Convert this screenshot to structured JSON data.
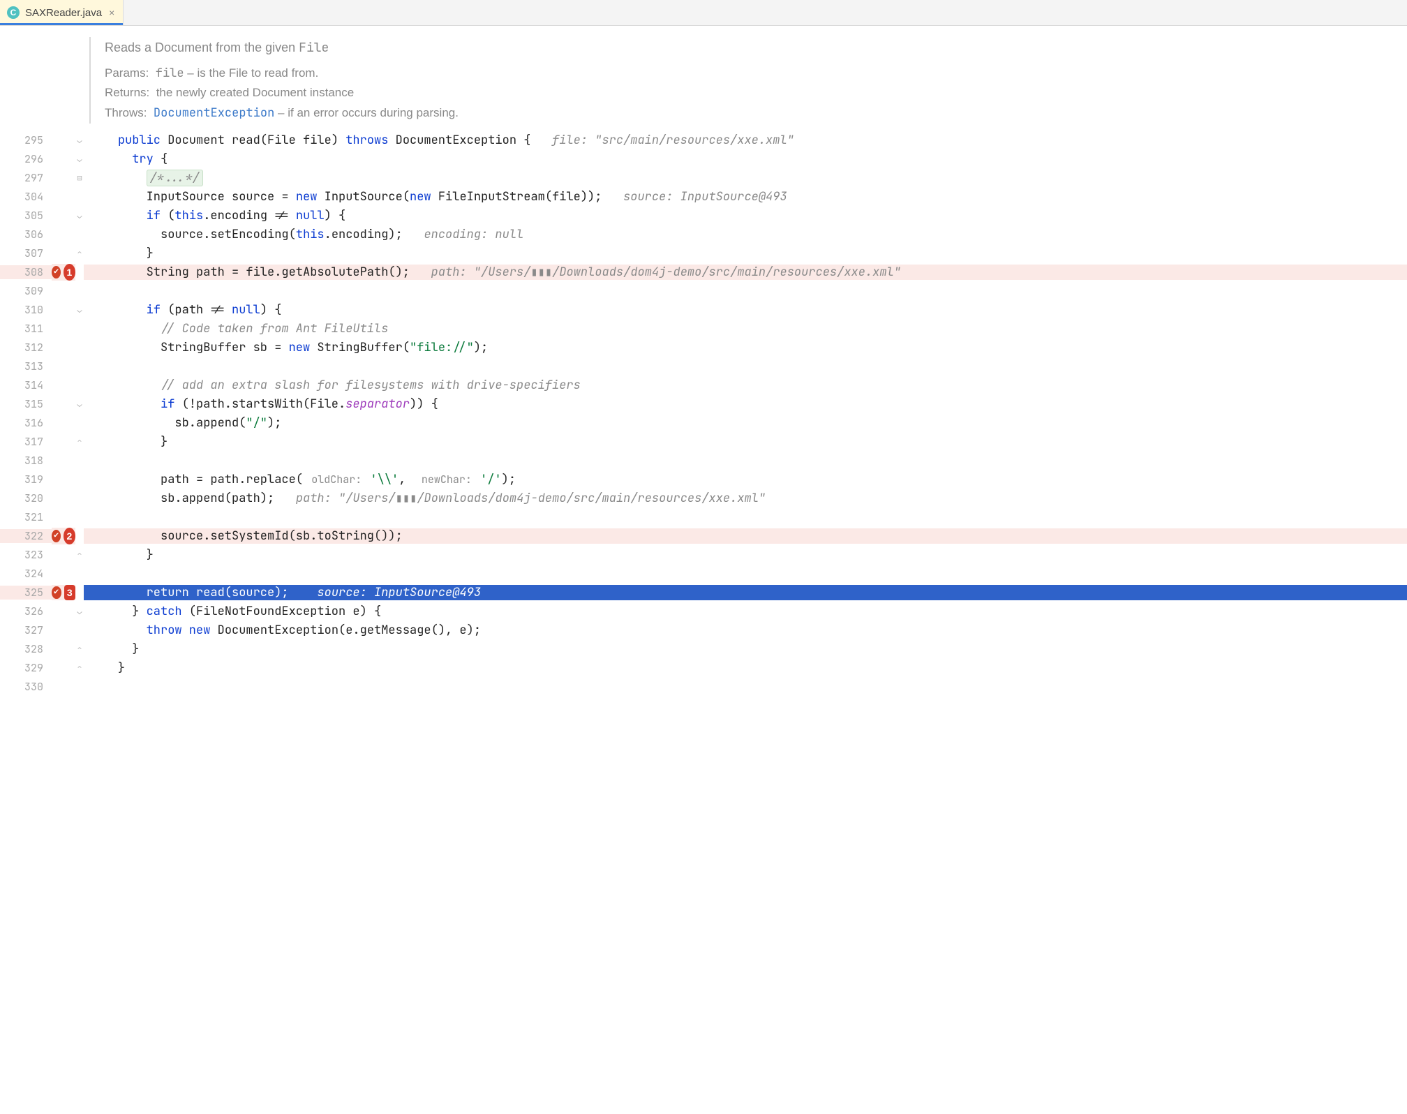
{
  "tab": {
    "filename": "SAXReader.java",
    "icon": "C"
  },
  "javadoc": {
    "summary_pre": "Reads a Document from the given ",
    "summary_type": "File",
    "params_label": "Params:",
    "params_val_mono": "file",
    "params_val_rest": " – is the File to read from.",
    "returns_label": "Returns:",
    "returns_val": "the newly created Document instance",
    "throws_label": "Throws:",
    "throws_link": "DocumentException",
    "throws_rest": " – if an error occurs during parsing."
  },
  "line_numbers": [
    "295",
    "296",
    "297",
    "304",
    "305",
    "306",
    "307",
    "308",
    "309",
    "310",
    "311",
    "312",
    "313",
    "314",
    "315",
    "316",
    "317",
    "318",
    "319",
    "320",
    "321",
    "322",
    "323",
    "324",
    "325",
    "326",
    "327",
    "328",
    "329",
    "330"
  ],
  "breakpoints": {
    "308": {
      "frame": "1"
    },
    "322": {
      "frame": "2"
    },
    "325": {
      "frame": "3",
      "exec": true
    }
  },
  "inlays": {
    "l295": "file: \"src/main/resources/xxe.xml\"",
    "l304": "source: InputSource@493",
    "l306": "encoding: null",
    "l308": "path: \"/Users/▮▮▮/Downloads/dom4j-demo/src/main/resources/xxe.xml\"",
    "l320": "path: \"/Users/▮▮▮/Downloads/dom4j-demo/src/main/resources/xxe.xml\"",
    "l325": "source: InputSource@493"
  },
  "param_hints": {
    "oldChar": "oldChar:",
    "newChar": "newChar:"
  },
  "code": {
    "l295_a": "public",
    "l295_b": " Document ",
    "l295_c": "read",
    "l295_d": "(File file) ",
    "l295_e": "throws",
    "l295_f": " DocumentException {",
    "l296": "try",
    "l296_b": " {",
    "l297": "/*...*/",
    "l304_a": "InputSource source = ",
    "l304_b": "new",
    "l304_c": " InputSource(",
    "l304_d": "new",
    "l304_e": " FileInputStream(file));",
    "l305_a": "if",
    "l305_b": " (",
    "l305_c": "this",
    "l305_d": ".encoding != ",
    "l305_e": "null",
    "l305_f": ") {",
    "l306_a": "source.setEncoding(",
    "l306_b": "this",
    "l306_c": ".encoding);",
    "l307": "}",
    "l308": "String path = file.getAbsolutePath();",
    "l310_a": "if",
    "l310_b": " (path != ",
    "l310_c": "null",
    "l310_d": ") {",
    "l311": "// Code taken from Ant FileUtils",
    "l312_a": "StringBuffer sb = ",
    "l312_b": "new",
    "l312_c": " StringBuffer(",
    "l312_d": "\"file://\"",
    "l312_e": ");",
    "l314": "// add an extra slash for filesystems with drive-specifiers",
    "l315_a": "if",
    "l315_b": " (!path.startsWith(File.",
    "l315_c": "separator",
    "l315_d": ")) {",
    "l316_a": "sb.append(",
    "l316_b": "\"/\"",
    "l316_c": ");",
    "l317": "}",
    "l319_a": "path = path.replace(",
    "l319_b": "'\\\\'",
    "l319_c": ", ",
    "l319_d": "'/'",
    "l319_e": ");",
    "l320": "sb.append(path);",
    "l322": "source.setSystemId(sb.toString());",
    "l323": "}",
    "l325_a": "return",
    "l325_b": " read(source);",
    "l326_a": "} ",
    "l326_b": "catch",
    "l326_c": " (FileNotFoundException e) {",
    "l327_a": "throw new",
    "l327_b": " DocumentException(e.getMessage(), e);",
    "l328": "}",
    "l329": "}"
  }
}
